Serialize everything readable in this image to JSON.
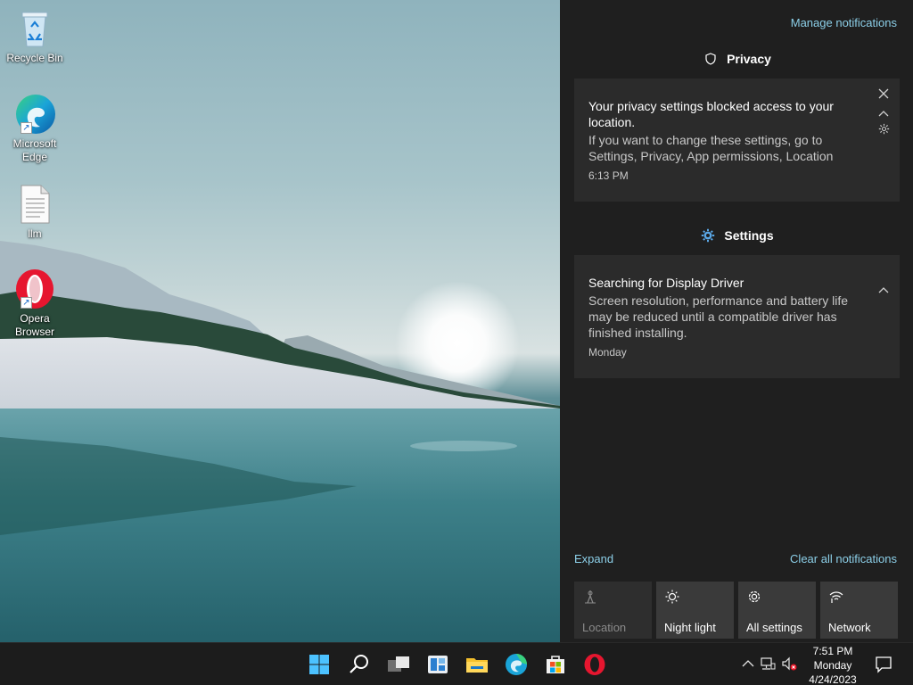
{
  "desktop": {
    "icons": [
      {
        "label": "Recycle Bin"
      },
      {
        "label": "Microsoft\nEdge"
      },
      {
        "label": "llm"
      },
      {
        "label": "Opera\nBrowser"
      }
    ]
  },
  "action_center": {
    "manage_notifications": "Manage notifications",
    "groups": [
      {
        "app": "Privacy",
        "notification": {
          "title": "Your privacy settings blocked access to your location.",
          "body": "If you want to change these settings, go to Settings, Privacy, App permissions, Location",
          "time": "6:13 PM"
        }
      },
      {
        "app": "Settings",
        "notification": {
          "title": "Searching for Display Driver",
          "body": "Screen resolution, performance and battery life may be reduced until a compatible driver has finished installing.",
          "time": "Monday"
        }
      }
    ],
    "expand": "Expand",
    "clear_all": "Clear all notifications",
    "quick_actions": [
      {
        "label": "Location",
        "icon": "location-icon",
        "state": "off"
      },
      {
        "label": "Night light",
        "icon": "night-light-icon",
        "state": "on"
      },
      {
        "label": "All settings",
        "icon": "gear-icon",
        "state": "on"
      },
      {
        "label": "Network",
        "icon": "network-icon",
        "state": "on"
      }
    ]
  },
  "taskbar": {
    "clock": {
      "time": "7:51 PM",
      "day": "Monday",
      "date": "4/24/2023"
    }
  },
  "colors": {
    "panel_bg": "#1f1f1f",
    "card_bg": "#2b2b2b",
    "link": "#8ccfe8",
    "taskbar_bg": "#1c1c1c"
  }
}
